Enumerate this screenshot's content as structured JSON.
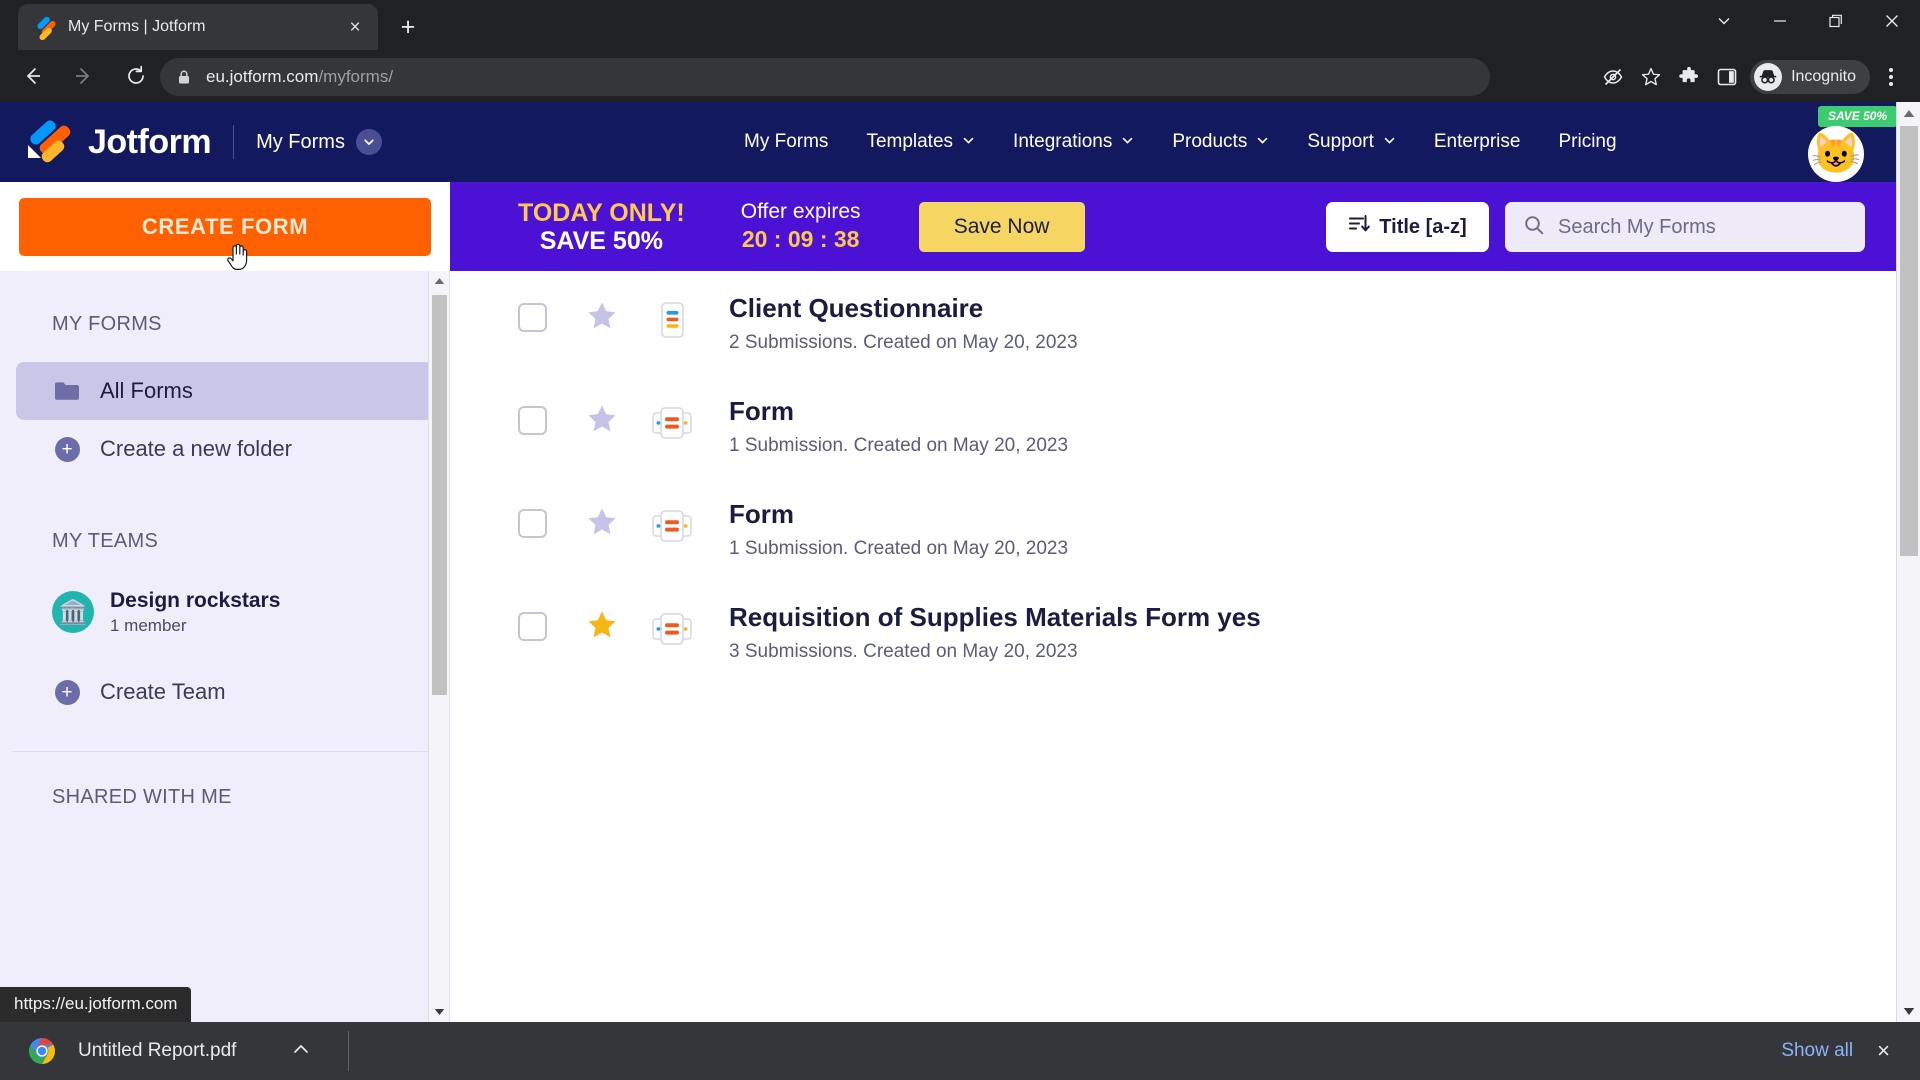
{
  "browser": {
    "tab": {
      "title": "My Forms | Jotform",
      "close_label": "×",
      "favicon": "jotform-favicon"
    },
    "new_tab_label": "+",
    "window_controls": [
      "chevron-down",
      "minimize",
      "maximize",
      "close"
    ],
    "nav": {
      "back": "back-arrow",
      "forward": "forward-arrow",
      "reload": "reload-icon"
    },
    "url": {
      "domain": "eu.jotform.com",
      "path": "/myforms/"
    },
    "omnibox_actions": [
      "eye-off-icon",
      "bookmark-star-icon",
      "extensions-puzzle-icon",
      "side-panel-icon"
    ],
    "profile": {
      "label": "Incognito",
      "icon": "incognito-icon"
    },
    "menu": "three-dot-menu",
    "status_bubble": "https://eu.jotform.com"
  },
  "header": {
    "brand": "Jotform",
    "my_forms_button": "My Forms",
    "nav_items": [
      {
        "label": "My Forms",
        "has_caret": false
      },
      {
        "label": "Templates",
        "has_caret": true
      },
      {
        "label": "Integrations",
        "has_caret": true
      },
      {
        "label": "Products",
        "has_caret": true
      },
      {
        "label": "Support",
        "has_caret": true
      },
      {
        "label": "Enterprise",
        "has_caret": false
      },
      {
        "label": "Pricing",
        "has_caret": false
      }
    ],
    "save_badge": "SAVE 50%",
    "avatar": "😺"
  },
  "toolbar": {
    "create_form_label": "CREATE FORM",
    "promo": {
      "headline_line1": "TODAY ONLY!",
      "headline_line2": "SAVE 50%",
      "expires_label": "Offer expires",
      "countdown": "20 : 09 : 38",
      "cta_label": "Save Now"
    },
    "sort_label": "Title [a-z]",
    "search_placeholder": "Search My Forms",
    "search_value": ""
  },
  "sidebar": {
    "my_forms_title": "MY FORMS",
    "all_forms_label": "All Forms",
    "create_folder_label": "Create a new folder",
    "my_teams_title": "MY TEAMS",
    "teams": [
      {
        "name": "Design rockstars",
        "members": "1 member",
        "avatar": "🏛️"
      }
    ],
    "create_team_label": "Create Team",
    "shared_with_me_title": "SHARED WITH ME"
  },
  "forms": [
    {
      "title": "Client Questionnaire",
      "meta": "2 Submissions. Created on May 20, 2023",
      "starred": false,
      "icon": "form-card-icon",
      "checked": false
    },
    {
      "title": "Form",
      "meta": "1 Submission. Created on May 20, 2023",
      "starred": false,
      "icon": "form-carousel-icon",
      "checked": false
    },
    {
      "title": "Form",
      "meta": "1 Submission. Created on May 20, 2023",
      "starred": false,
      "icon": "form-carousel-icon",
      "checked": false
    },
    {
      "title": "Requisition of Supplies Materials Form yes",
      "meta": "3 Submissions. Created on May 20, 2023",
      "starred": true,
      "icon": "form-carousel-icon",
      "checked": false
    }
  ],
  "downloads": {
    "file_name": "Untitled Report.pdf",
    "expand_label": "^",
    "show_all_label": "Show all",
    "close_label": "×"
  },
  "colors": {
    "brand_navy": "#13195e",
    "brand_orange": "#ff6100",
    "promo_purple": "#4b11d4",
    "promo_gold": "#ffc94d",
    "cta_yellow": "#f5d663",
    "badge_green": "#3dcb6f",
    "sidebar_bg": "#f0eefb",
    "sidebar_active": "#c9c7e8",
    "star_gold": "#f5b616",
    "link_blue": "#8ab4f8"
  }
}
